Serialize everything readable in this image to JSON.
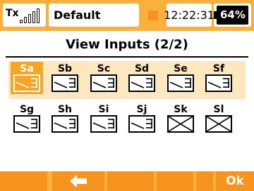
{
  "status_bar": {
    "tx_label": "Tx",
    "signal_icon": "signal-bars-icon",
    "model_name": "Default",
    "time": "12:22:31",
    "battery_percent": "64%",
    "battery_icon": "battery-icon"
  },
  "page": {
    "title": "View Inputs (2/2)"
  },
  "inputs": {
    "row1": [
      {
        "label": "Sa",
        "icon": "switch-position-icon",
        "selected": true
      },
      {
        "label": "Sb",
        "icon": "switch-position-icon",
        "selected": false
      },
      {
        "label": "Sc",
        "icon": "switch-position-icon",
        "selected": false
      },
      {
        "label": "Sd",
        "icon": "switch-position-icon",
        "selected": false
      },
      {
        "label": "Se",
        "icon": "switch-position-icon",
        "selected": false
      },
      {
        "label": "Sf",
        "icon": "switch-position-icon",
        "selected": false
      }
    ],
    "row2": [
      {
        "label": "Sg",
        "icon": "switch-position-icon",
        "selected": false
      },
      {
        "label": "Sh",
        "icon": "switch-position-icon",
        "selected": false
      },
      {
        "label": "Si",
        "icon": "switch-position-icon",
        "selected": false
      },
      {
        "label": "Sj",
        "icon": "switch-position-icon",
        "selected": false
      },
      {
        "label": "Sk",
        "icon": "unavailable-x-icon",
        "selected": false
      },
      {
        "label": "Sl",
        "icon": "unavailable-x-icon",
        "selected": false
      }
    ]
  },
  "softkeys": {
    "key1": "",
    "key2": "back-arrow-icon",
    "key3": "",
    "key4": "",
    "key5": "",
    "ok_label": "Ok"
  },
  "colors": {
    "accent": "#fbb03b",
    "accent_dark": "#f7941d",
    "selected_tile": "#f7a623",
    "row_highlight": "#fde7bf"
  }
}
